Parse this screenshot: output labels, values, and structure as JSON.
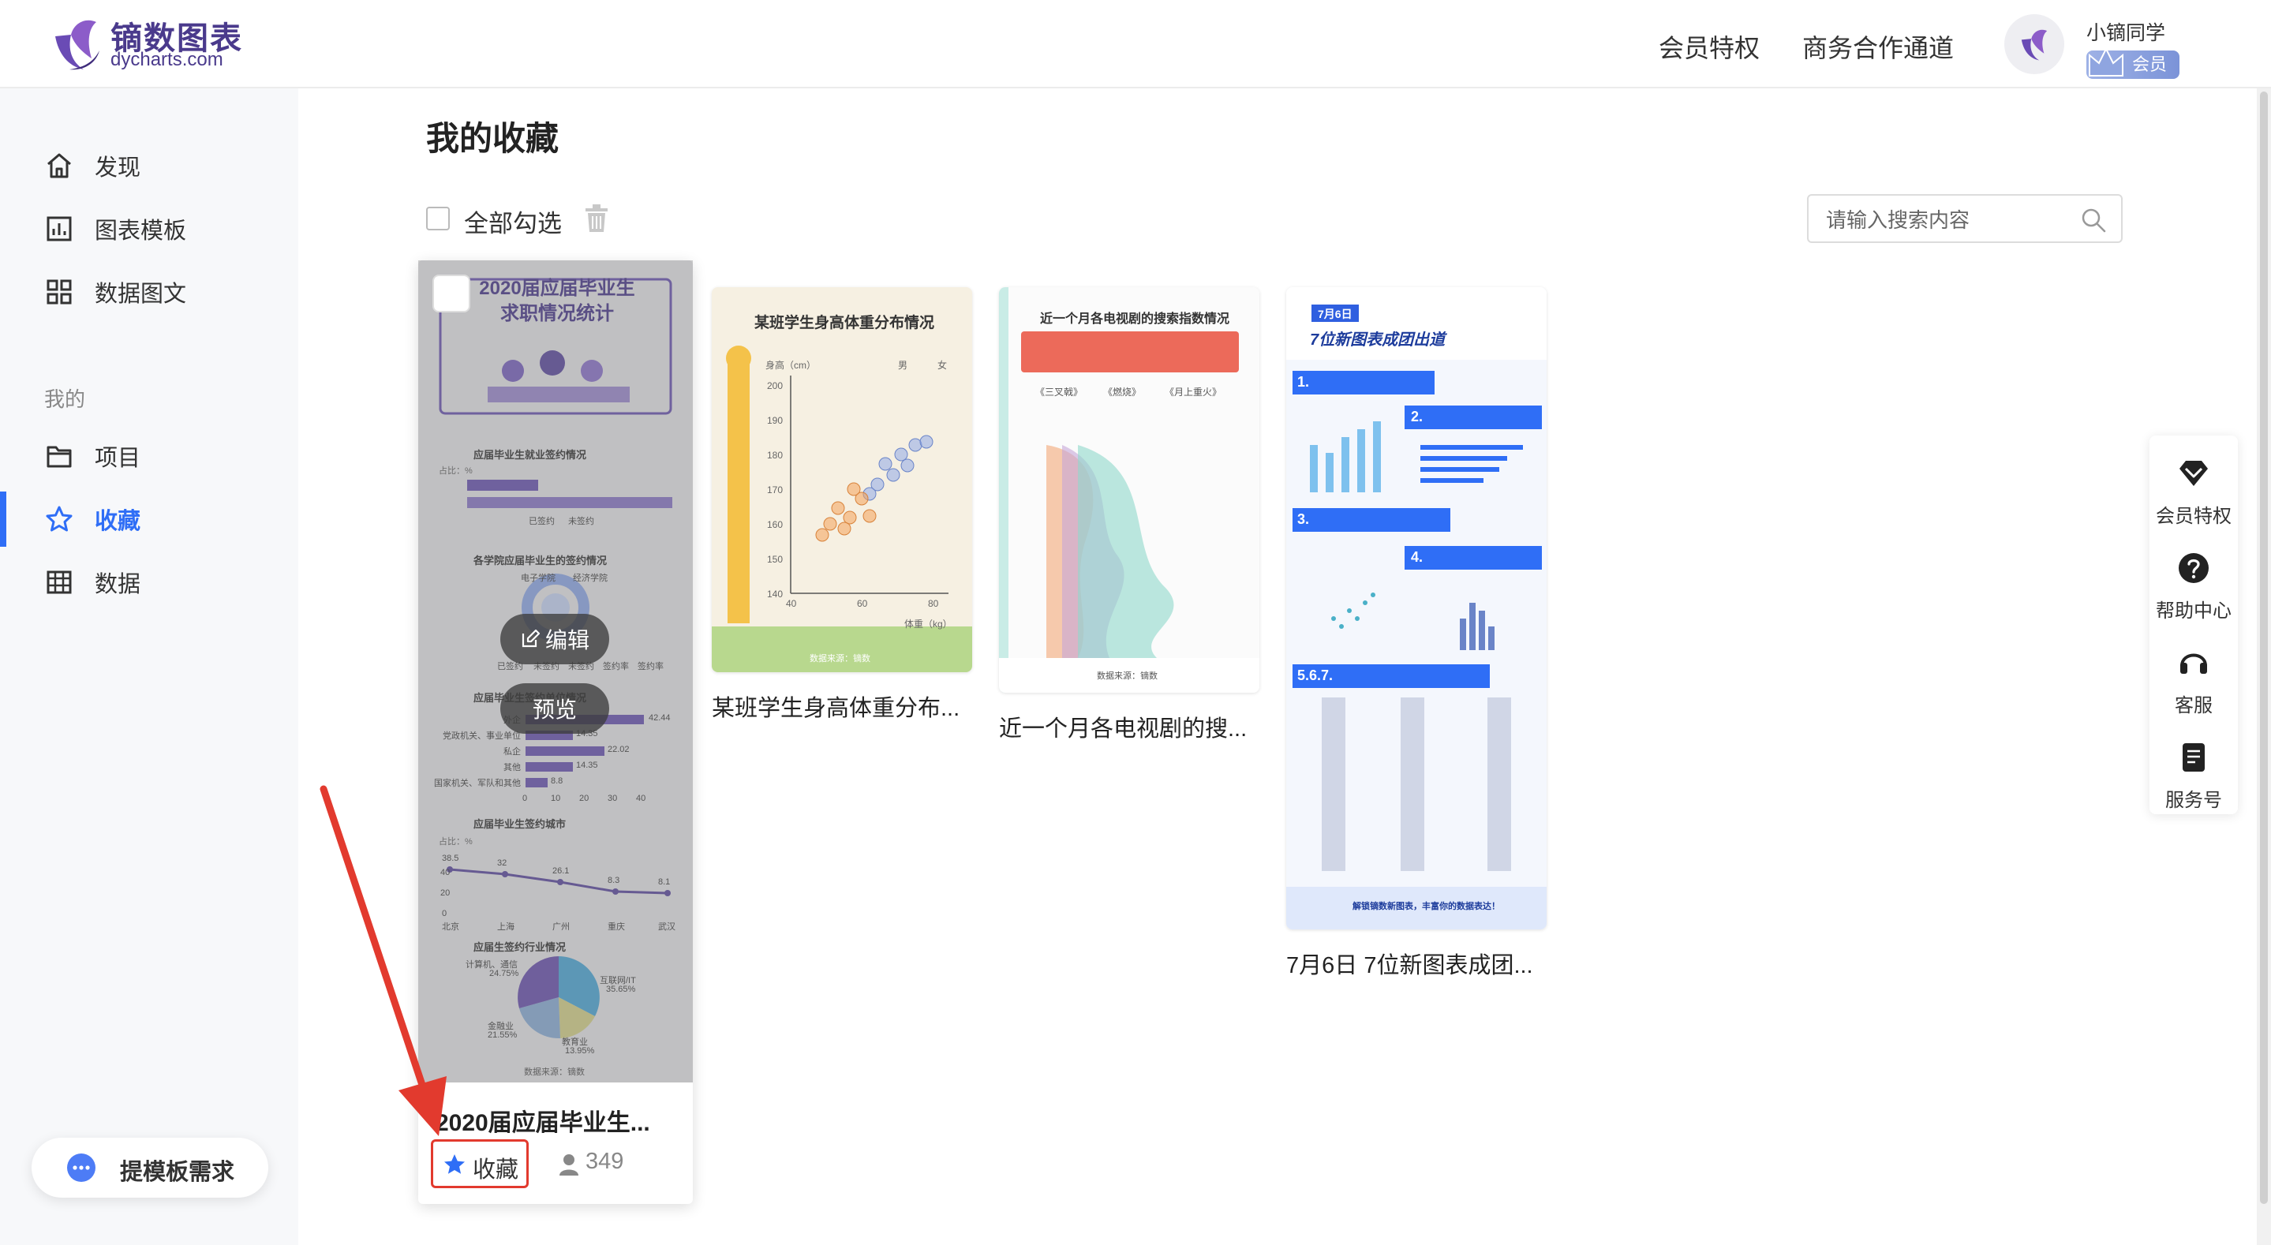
{
  "header": {
    "logo_cn": "镝数图表",
    "logo_en": "dycharts.com",
    "nav": [
      "会员特权",
      "商务合作通道"
    ],
    "user_name": "小镝同学",
    "member_badge": "会员"
  },
  "sidebar": {
    "items": [
      {
        "label": "发现",
        "icon": "home-icon"
      },
      {
        "label": "图表模板",
        "icon": "bar-chart-icon"
      },
      {
        "label": "数据图文",
        "icon": "grid-icon"
      }
    ],
    "section_label": "我的",
    "my_items": [
      {
        "label": "项目",
        "icon": "folder-icon"
      },
      {
        "label": "收藏",
        "icon": "star-icon",
        "active": true
      },
      {
        "label": "数据",
        "icon": "table-icon"
      }
    ],
    "template_request": "提模板需求"
  },
  "main": {
    "title": "我的收藏",
    "select_all": "全部勾选",
    "search_placeholder": "请输入搜索内容",
    "cards": [
      {
        "title": "2020届应届毕业生...",
        "thumb_title": "2020届应届毕业生\n求职情况统计",
        "edit_label": "编辑",
        "preview_label": "预览",
        "fav_label": "收藏",
        "users": "349",
        "thumb_texts": {
          "s1": "应届毕业生就业签约情况",
          "s1_unit": "占比：%",
          "s1_legend": [
            "已签约",
            "未签约"
          ],
          "s2": "各学院应届毕业生的签约情况",
          "s2_labels": [
            "电子学院",
            "经济学院"
          ],
          "s2_legend": [
            "已签约",
            "未签约",
            "未签约",
            "签约率",
            "签约率"
          ],
          "s3": "应届毕业生签约单位情况",
          "s3_rows": [
            {
              "label": "外企",
              "value": "42.44"
            },
            {
              "label": "党政机关、事业单位",
              "value": "14.35"
            },
            {
              "label": "私企",
              "value": "22.02"
            },
            {
              "label": "其他",
              "value": "14.35"
            },
            {
              "label": "国家机关、军队和其他",
              "value": "8.8"
            }
          ],
          "s3_axis": [
            "0",
            "10",
            "20",
            "30",
            "40"
          ],
          "s4": "应届毕业生签约城市",
          "s4_unit": "占比：%",
          "s4_values": [
            "38.5",
            "32",
            "26.1",
            "8.3",
            "8.1"
          ],
          "s4_cities": [
            "北京",
            "上海",
            "广州",
            "重庆",
            "武汉"
          ],
          "s4_axis": [
            "40",
            "20",
            "0"
          ],
          "s5": "应届生签约行业情况",
          "s5_labels": [
            {
              "name": "计算机、通信",
              "value": "24.75%"
            },
            {
              "name": "互联网/IT",
              "value": "35.65%"
            },
            {
              "name": "金融业",
              "value": "21.55%"
            },
            {
              "name": "教育业",
              "value": "13.95%"
            }
          ],
          "source": "数据来源：镝数"
        }
      },
      {
        "title": "某班学生身高体重分布...",
        "thumb_title": "某班学生身高体重分布情况",
        "y_label": "身高（cm）",
        "x_label": "体重（kg）",
        "legend": [
          "男",
          "女"
        ],
        "y_ticks": [
          "200",
          "190",
          "180",
          "170",
          "160",
          "150",
          "140"
        ],
        "x_ticks": [
          "40",
          "60",
          "80"
        ],
        "source": "数据来源：镝数"
      },
      {
        "title": "近一个月各电视剧的搜...",
        "thumb_title": "近一个月各电视剧的搜索指数情况",
        "shows": [
          "《三叉戟》",
          "《燃烧》",
          "《月上重火》"
        ],
        "source": "数据来源：镝数"
      },
      {
        "title": "7月6日 7位新图表成团...",
        "thumb_tag": "7月6日",
        "thumb_title": "7位新图表成团出道",
        "sections": [
          "1.",
          "2.",
          "3.",
          "4.",
          "5.6.7."
        ],
        "footer": "解锁镝数新图表，丰富你的数据表达！"
      }
    ]
  },
  "float_panel": {
    "items": [
      {
        "label": "会员特权",
        "icon": "diamond-icon"
      },
      {
        "label": "帮助中心",
        "icon": "help-icon"
      },
      {
        "label": "客服",
        "icon": "headset-icon"
      },
      {
        "label": "服务号",
        "icon": "doc-icon"
      }
    ]
  },
  "colors": {
    "accent": "#2f6ef6",
    "brand": "#4a3a8c",
    "annotation": "#e23a2e"
  }
}
